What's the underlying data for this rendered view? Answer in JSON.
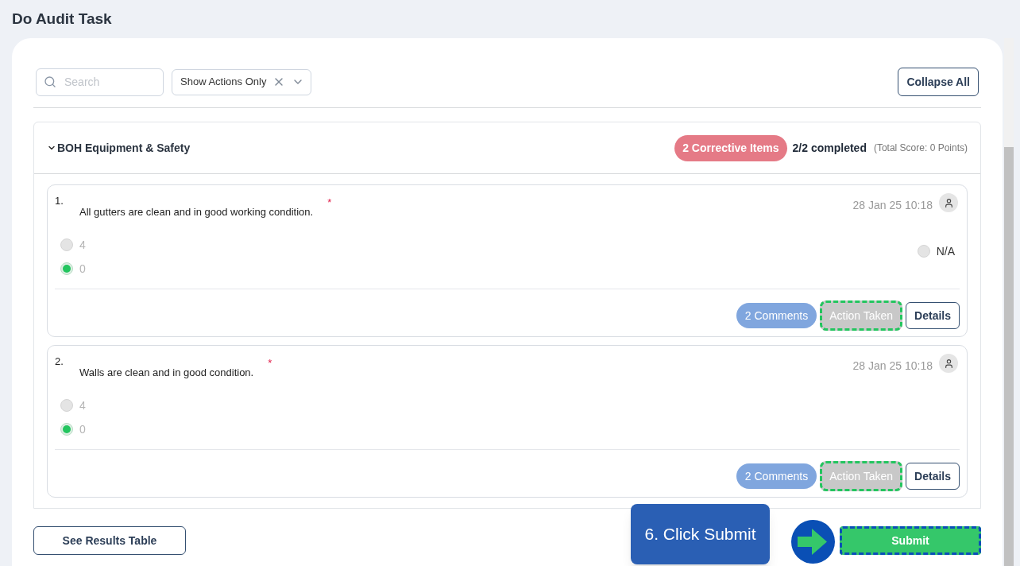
{
  "page_title": "Do Audit Task",
  "toolbar": {
    "search": {
      "placeholder": "Search"
    },
    "filter": {
      "value": "Show Actions Only"
    },
    "collapse_button": "Collapse All"
  },
  "section": {
    "title": "BOH Equipment & Safety",
    "expanded": true,
    "corrective_badge": "2 Corrective Items",
    "completed": "2/2 completed",
    "total_score": "(Total Score: 0 Points)",
    "questions": [
      {
        "number": "1.",
        "text": "All gutters are clean and in good working condition.",
        "required_mark": "*",
        "timestamp": "28 Jan 25 10:18",
        "options": [
          {
            "label": "4",
            "selected": false
          },
          {
            "label": "0",
            "selected": true
          }
        ],
        "na_option": {
          "label": "N/A",
          "selected": false
        },
        "comments_button": "2 Comments",
        "action_button": {
          "label": "Action Taken",
          "highlighted": true
        },
        "details_button": "Details"
      },
      {
        "number": "2.",
        "text": "Walls are clean and in good condition.",
        "required_mark": "*",
        "timestamp": "28 Jan 25 10:18",
        "options": [
          {
            "label": "4",
            "selected": false
          },
          {
            "label": "0",
            "selected": true
          }
        ],
        "comments_button": "2 Comments",
        "action_button": {
          "label": "Action Taken",
          "highlighted": true
        },
        "details_button": "Details"
      }
    ]
  },
  "footer": {
    "results_button": "See Results Table",
    "submit_button": {
      "label": "Submit",
      "highlighted": true
    }
  },
  "guide": {
    "callout": "6. Click Submit"
  }
}
